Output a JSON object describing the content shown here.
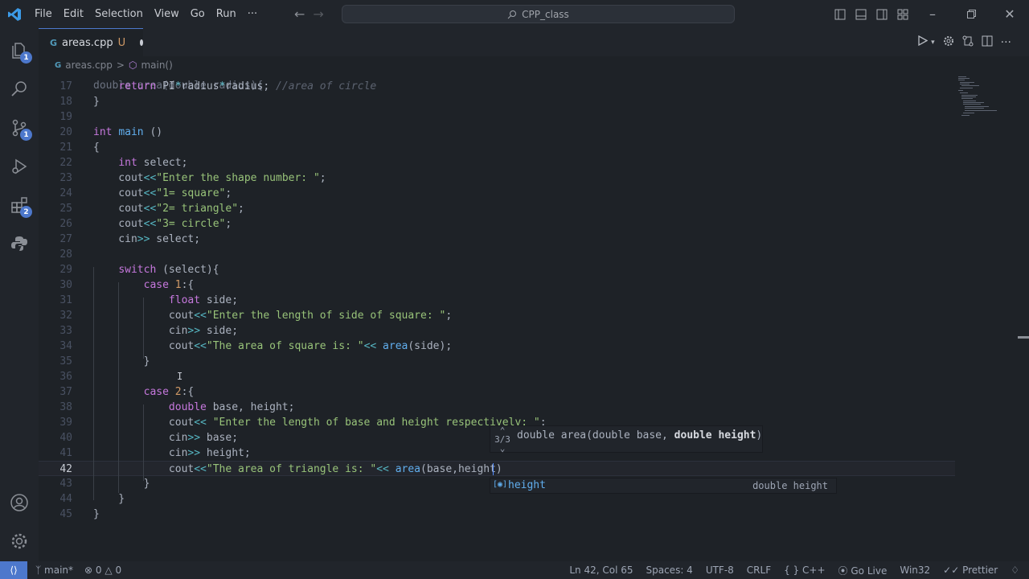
{
  "menu": [
    "File",
    "Edit",
    "Selection",
    "View",
    "Go",
    "Run",
    "···"
  ],
  "search": {
    "text": "CPP_class"
  },
  "tab": {
    "glyph": "G",
    "name": "areas.cpp",
    "status": "U"
  },
  "breadcrumb": {
    "file": "areas.cpp",
    "sep": ">",
    "symbol": "main()"
  },
  "activity_badges": {
    "explorer": "1",
    "scm": "1",
    "extensions": "2"
  },
  "code_lines": [
    {
      "n": "17",
      "html": "    <span class='kw'>return</span> <span class='pl'>PI</span><span class='op'>*</span><span class='pl'>radius</span><span class='op'>*</span><span class='pl'>radius</span>; <span class='cm'>//area of circle</span>"
    },
    {
      "n": "18",
      "html": "}"
    },
    {
      "n": "19",
      "html": ""
    },
    {
      "n": "20",
      "html": "<span class='ty'>int</span> <span class='fn'>main</span> ()"
    },
    {
      "n": "21",
      "html": "{"
    },
    {
      "n": "22",
      "html": "    <span class='ty'>int</span> select;"
    },
    {
      "n": "23",
      "html": "    cout<span class='op'>&lt;&lt;</span><span class='str'>\"Enter the shape number: \"</span>;"
    },
    {
      "n": "24",
      "html": "    cout<span class='op'>&lt;&lt;</span><span class='str'>\"1= square\"</span>;"
    },
    {
      "n": "25",
      "html": "    cout<span class='op'>&lt;&lt;</span><span class='str'>\"2= triangle\"</span>;"
    },
    {
      "n": "26",
      "html": "    cout<span class='op'>&lt;&lt;</span><span class='str'>\"3= circle\"</span>;"
    },
    {
      "n": "27",
      "html": "    cin<span class='op'>&gt;&gt;</span> select;"
    },
    {
      "n": "28",
      "html": ""
    },
    {
      "n": "29",
      "html": "    <span class='kw'>switch</span> (select){"
    },
    {
      "n": "30",
      "html": "        <span class='kw'>case</span> <span class='num'>1</span>:{"
    },
    {
      "n": "31",
      "html": "            <span class='ty'>float</span> side;"
    },
    {
      "n": "32",
      "html": "            cout<span class='op'>&lt;&lt;</span><span class='str'>\"Enter the length of side of square: \"</span>;"
    },
    {
      "n": "33",
      "html": "            cin<span class='op'>&gt;&gt;</span> side;"
    },
    {
      "n": "34",
      "html": "            cout<span class='op'>&lt;&lt;</span><span class='str'>\"The area of square is: \"</span><span class='op'>&lt;&lt;</span> <span class='fn'>area</span>(side);"
    },
    {
      "n": "35",
      "html": "        }"
    },
    {
      "n": "36",
      "html": ""
    },
    {
      "n": "37",
      "html": "        <span class='kw'>case</span> <span class='num'>2</span>:{"
    },
    {
      "n": "38",
      "html": "            <span class='ty'>double</span> base, height;"
    },
    {
      "n": "39",
      "html": "            cout<span class='op'>&lt;&lt;</span> <span class='str'>\"Enter the length of base and height respectively: \"</span>;"
    },
    {
      "n": "40",
      "html": "            cin<span class='op'>&gt;&gt;</span> base;"
    },
    {
      "n": "41",
      "html": "            cin<span class='op'>&gt;&gt;</span> height;"
    },
    {
      "n": "42",
      "html": "            cout<span class='op'>&lt;&lt;</span><span class='str'>\"The area of triangle is: \"</span><span class='op'>&lt;&lt;</span> <span class='fn'>area</span>(base,height)"
    },
    {
      "n": "43",
      "html": "        }"
    },
    {
      "n": "44",
      "html": "    }"
    },
    {
      "n": "45",
      "html": "}"
    }
  ],
  "param_hint": {
    "pager": "3/3",
    "sig_prefix": "double area(double base, ",
    "sig_active": "double height",
    "sig_suffix": ")"
  },
  "suggestion": {
    "label": "height",
    "detail": "double height"
  },
  "status": {
    "branch": "main*",
    "errors": "0",
    "warnings": "0",
    "position": "Ln 42, Col 65",
    "spaces": "Spaces: 4",
    "encoding": "UTF-8",
    "eol": "CRLF",
    "language": "C++",
    "golive": "Go Live",
    "platform": "Win32",
    "prettier": "Prettier"
  }
}
